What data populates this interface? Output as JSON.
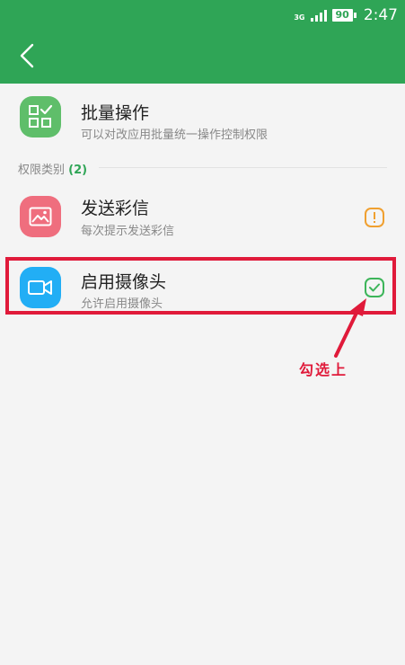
{
  "status_bar": {
    "network": "3G",
    "battery": "90",
    "time": "2:47"
  },
  "toolbar": {
    "back_icon": "chevron-left-icon"
  },
  "batch": {
    "title": "批量操作",
    "subtitle": "可以对改应用批量统一操作控制权限",
    "icon": "grid-check-icon",
    "icon_color": "#5fbe6a"
  },
  "section": {
    "label": "权限类别",
    "count": "(2)"
  },
  "permissions": [
    {
      "title": "发送彩信",
      "subtitle": "每次提示发送彩信",
      "icon": "image-icon",
      "icon_color": "#ef6e7e",
      "status": "ask",
      "status_icon": "exclamation-icon",
      "status_color": "#f0a030"
    },
    {
      "title": "启用摄像头",
      "subtitle": "允许启用摄像头",
      "icon": "video-camera-icon",
      "icon_color": "#22aef5",
      "status": "allowed",
      "status_icon": "check-icon",
      "status_color": "#3db55a"
    }
  ],
  "annotation": {
    "text": "勾选上",
    "color": "#e01a3a"
  },
  "colors": {
    "primary": "#2fa556",
    "background": "#f4f4f4"
  }
}
